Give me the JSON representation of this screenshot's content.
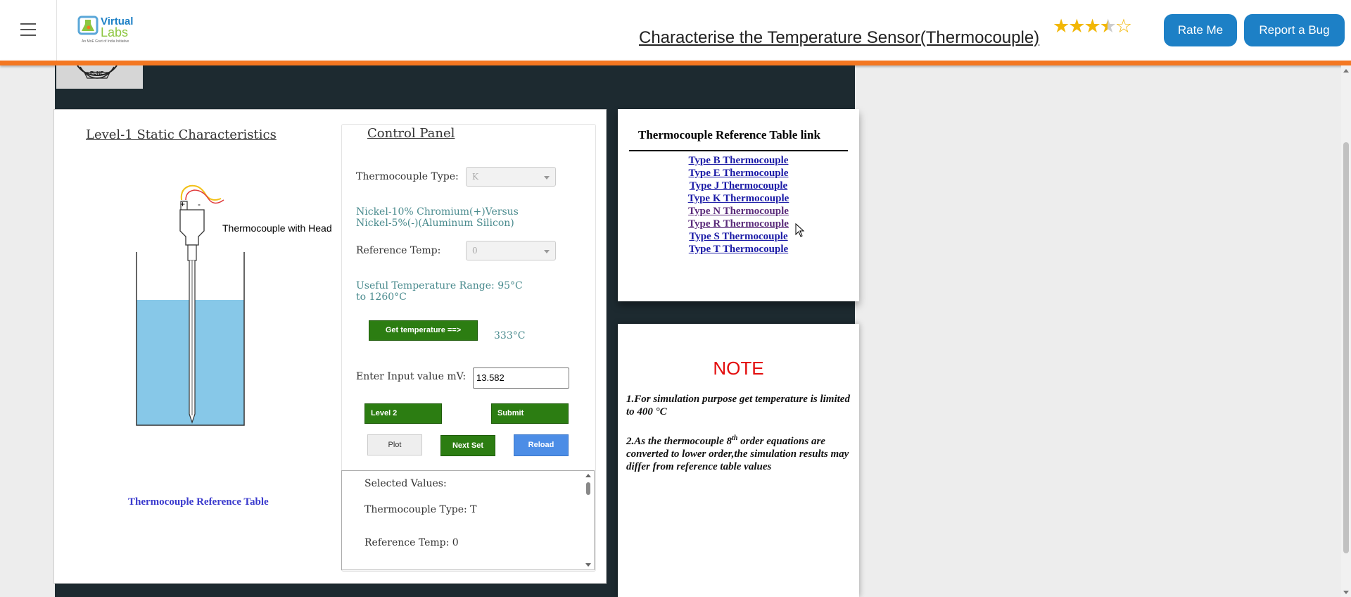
{
  "header": {
    "title": "Characterise the Temperature Sensor(Thermocouple)",
    "rating": 3.5,
    "rate_label": "Rate Me",
    "bug_label": "Report a Bug",
    "logo_main": "Virtual",
    "logo_sub": "Labs",
    "logo_tag": "An MoE Govt of India Initiative",
    "accent_color": "#f47721",
    "button_color": "#1d80c6"
  },
  "college_logo_text": "PUNE",
  "experiment": {
    "title": "Level-1 Static Characteristics",
    "diagram_label": "Thermocouple with Head",
    "plus": "+",
    "minus": "-",
    "ref_table_link": "Thermocouple Reference Table"
  },
  "control_panel": {
    "title": "Control Panel",
    "type_label": "Thermocouple Type:",
    "type_value": "K",
    "type_description": "Nickel-10% Chromium(+)Versus Nickel-5%(-)(Aluminum Silicon)",
    "ref_temp_label": "Reference Temp:",
    "ref_temp_value": "0",
    "range_text": "Useful Temperature Range: 95°C to 1260°C",
    "get_temp_label": "Get temperature ==>",
    "temperature_value": "333°C",
    "input_label": "Enter Input value mV:",
    "input_value": "13.582",
    "level2_label": "Level 2",
    "submit_label": "Submit",
    "plot_label": "Plot",
    "next_set_label": "Next Set",
    "reload_label": "Reload"
  },
  "selected_values": {
    "heading": "Selected Values:",
    "type_line": "Thermocouple Type: T",
    "ref_line": "Reference Temp: 0"
  },
  "reference_links": {
    "title": "Thermocouple Reference Table link",
    "items": [
      "Type B Thermocouple",
      "Type E Thermocouple",
      "Type J Thermocouple",
      "Type K Thermocouple",
      "Type N Thermocouple",
      "Type R Thermocouple",
      "Type S Thermocouple",
      "Type T Thermocouple"
    ]
  },
  "note": {
    "title": "NOTE",
    "line1": "1.For simulation purpose get temperature is limited to 400 °C",
    "line2_prefix": "2.As the thermocouple 8",
    "line2_sup": "th",
    "line2_suffix": " order equations are converted to lower order,the simulation results may differ from reference table values"
  }
}
